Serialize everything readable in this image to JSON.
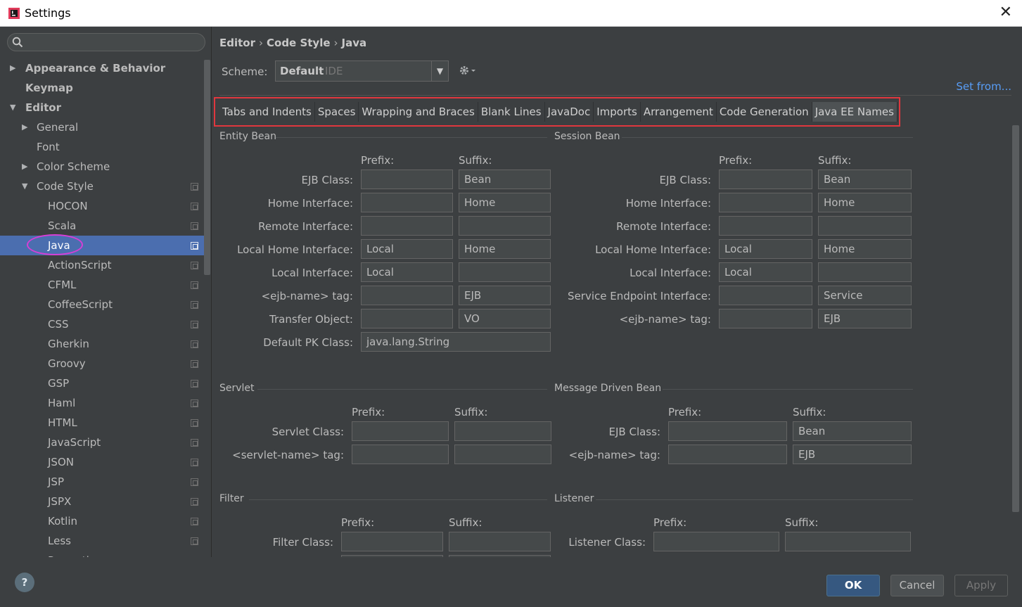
{
  "window": {
    "title": "Settings",
    "close_glyph": "✕"
  },
  "sidebar": {
    "search_placeholder": "",
    "items": [
      {
        "label": "Appearance & Behavior",
        "bold": true,
        "arrow": "▶",
        "level": 0
      },
      {
        "label": "Keymap",
        "bold": true,
        "arrow": "",
        "level": 0
      },
      {
        "label": "Editor",
        "bold": true,
        "arrow": "▼",
        "level": 0
      },
      {
        "label": "General",
        "bold": false,
        "arrow": "▶",
        "level": 1
      },
      {
        "label": "Font",
        "bold": false,
        "arrow": "",
        "level": 1
      },
      {
        "label": "Color Scheme",
        "bold": false,
        "arrow": "▶",
        "level": 1
      },
      {
        "label": "Code Style",
        "bold": false,
        "arrow": "▼",
        "level": 1,
        "copy": true
      },
      {
        "label": "HOCON",
        "level": 2,
        "copy": true
      },
      {
        "label": "Scala",
        "level": 2,
        "copy": true
      },
      {
        "label": "Java",
        "level": 2,
        "copy": true,
        "selected": true
      },
      {
        "label": "ActionScript",
        "level": 2,
        "copy": true
      },
      {
        "label": "CFML",
        "level": 2,
        "copy": true
      },
      {
        "label": "CoffeeScript",
        "level": 2,
        "copy": true
      },
      {
        "label": "CSS",
        "level": 2,
        "copy": true
      },
      {
        "label": "Gherkin",
        "level": 2,
        "copy": true
      },
      {
        "label": "Groovy",
        "level": 2,
        "copy": true
      },
      {
        "label": "GSP",
        "level": 2,
        "copy": true
      },
      {
        "label": "Haml",
        "level": 2,
        "copy": true
      },
      {
        "label": "HTML",
        "level": 2,
        "copy": true
      },
      {
        "label": "JavaScript",
        "level": 2,
        "copy": true
      },
      {
        "label": "JSON",
        "level": 2,
        "copy": true
      },
      {
        "label": "JSP",
        "level": 2,
        "copy": true
      },
      {
        "label": "JSPX",
        "level": 2,
        "copy": true
      },
      {
        "label": "Kotlin",
        "level": 2,
        "copy": true
      },
      {
        "label": "Less",
        "level": 2,
        "copy": true
      },
      {
        "label": "Properties",
        "level": 2,
        "copy": true
      }
    ]
  },
  "breadcrumb": [
    "Editor",
    "Code Style",
    "Java"
  ],
  "scheme": {
    "label": "Scheme:",
    "name": "Default",
    "sub": "IDE",
    "set_from": "Set from..."
  },
  "tabs": [
    "Tabs and Indents",
    "Spaces",
    "Wrapping and Braces",
    "Blank Lines",
    "JavaDoc",
    "Imports",
    "Arrangement",
    "Code Generation",
    "Java EE Names"
  ],
  "active_tab": "Java EE Names",
  "entity_bean": {
    "title": "Entity Bean",
    "prefix": "Prefix:",
    "suffix": "Suffix:",
    "rows": [
      {
        "label": "EJB Class:",
        "prefix": "",
        "suffix": "Bean"
      },
      {
        "label": "Home Interface:",
        "prefix": "",
        "suffix": "Home"
      },
      {
        "label": "Remote Interface:",
        "prefix": "",
        "suffix": ""
      },
      {
        "label": "Local Home Interface:",
        "prefix": "Local",
        "suffix": "Home"
      },
      {
        "label": "Local Interface:",
        "prefix": "Local",
        "suffix": ""
      },
      {
        "label": "<ejb-name> tag:",
        "prefix": "",
        "suffix": "EJB"
      },
      {
        "label": "Transfer Object:",
        "prefix": "",
        "suffix": "VO"
      }
    ],
    "pk_label": "Default PK Class:",
    "pk_value": "java.lang.String"
  },
  "session_bean": {
    "title": "Session Bean",
    "prefix": "Prefix:",
    "suffix": "Suffix:",
    "rows": [
      {
        "label": "EJB Class:",
        "prefix": "",
        "suffix": "Bean"
      },
      {
        "label": "Home Interface:",
        "prefix": "",
        "suffix": "Home"
      },
      {
        "label": "Remote Interface:",
        "prefix": "",
        "suffix": ""
      },
      {
        "label": "Local Home Interface:",
        "prefix": "Local",
        "suffix": "Home"
      },
      {
        "label": "Local Interface:",
        "prefix": "Local",
        "suffix": ""
      },
      {
        "label": "Service Endpoint Interface:",
        "prefix": "",
        "suffix": "Service"
      },
      {
        "label": "<ejb-name> tag:",
        "prefix": "",
        "suffix": "EJB"
      }
    ]
  },
  "servlet": {
    "title": "Servlet",
    "prefix": "Prefix:",
    "suffix": "Suffix:",
    "rows": [
      {
        "label": "Servlet Class:",
        "prefix": "",
        "suffix": ""
      },
      {
        "label": "<servlet-name> tag:",
        "prefix": "",
        "suffix": ""
      }
    ]
  },
  "mdb": {
    "title": "Message Driven Bean",
    "prefix": "Prefix:",
    "suffix": "Suffix:",
    "rows": [
      {
        "label": "EJB Class:",
        "prefix": "",
        "suffix": "Bean"
      },
      {
        "label": "<ejb-name> tag:",
        "prefix": "",
        "suffix": "EJB"
      }
    ]
  },
  "filter": {
    "title": "Filter",
    "prefix": "Prefix:",
    "suffix": "Suffix:",
    "rows": [
      {
        "label": "Filter Class:",
        "prefix": "",
        "suffix": ""
      }
    ]
  },
  "listener": {
    "title": "Listener",
    "prefix": "Prefix:",
    "suffix": "Suffix:",
    "rows": [
      {
        "label": "Listener Class:",
        "prefix": "",
        "suffix": ""
      }
    ]
  },
  "footer": {
    "help": "?",
    "ok": "OK",
    "cancel": "Cancel",
    "apply": "Apply"
  },
  "colors": {
    "background": "#3c3f41",
    "selection": "#4b6eaf",
    "link": "#589df6",
    "annotation_red": "#e0373e",
    "annotation_magenta": "#d63fd6"
  }
}
